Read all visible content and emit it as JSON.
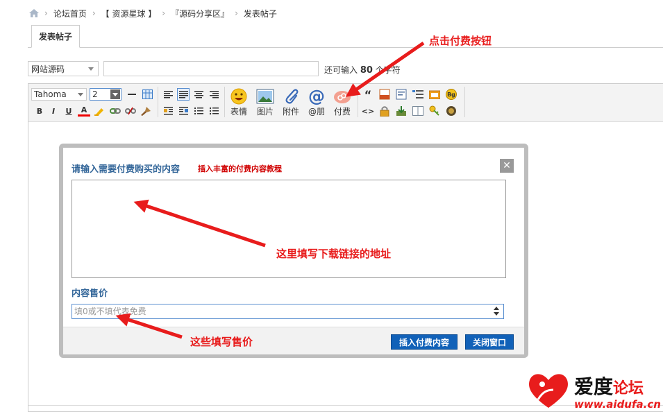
{
  "breadcrumb": {
    "items": [
      "论坛首页",
      "【 资源星球 】",
      "『源码分享区』",
      "发表帖子"
    ],
    "separator": "›"
  },
  "tab": {
    "label": "发表帖子"
  },
  "title_row": {
    "category_select": "网站源码",
    "remaining_prefix": "还可输入",
    "remaining_count": "80",
    "remaining_suffix": "个字符"
  },
  "toolbar": {
    "font": "Tahoma",
    "size": "2",
    "format_buttons": [
      "B",
      "I",
      "U",
      "A"
    ],
    "big_buttons": [
      {
        "label": "表情",
        "icon": "smiley-icon"
      },
      {
        "label": "图片",
        "icon": "image-icon"
      },
      {
        "label": "附件",
        "icon": "paperclip-icon"
      },
      {
        "label": "@朋",
        "icon": "at-icon"
      },
      {
        "label": "付费",
        "icon": "paid-icon"
      }
    ]
  },
  "dialog": {
    "title": "请输入需要付费购买的内容",
    "tutorial_link": "插入丰富的付费内容教程",
    "close": "✕",
    "price_label": "内容售价",
    "price_placeholder": "填0或不填代表免费",
    "insert_button": "插入付费内容",
    "close_button": "关闭窗口"
  },
  "annotations": {
    "click_paid": "点击付费按钮",
    "fill_link": "这里填写下载链接的地址",
    "fill_price": "这些填写售价"
  },
  "logo": {
    "name": "爱度",
    "suffix": "论坛",
    "url": "www.aidufa.cn"
  },
  "colors": {
    "accent": "#1161b8",
    "annotation": "#e81c1c",
    "label": "#336699"
  }
}
